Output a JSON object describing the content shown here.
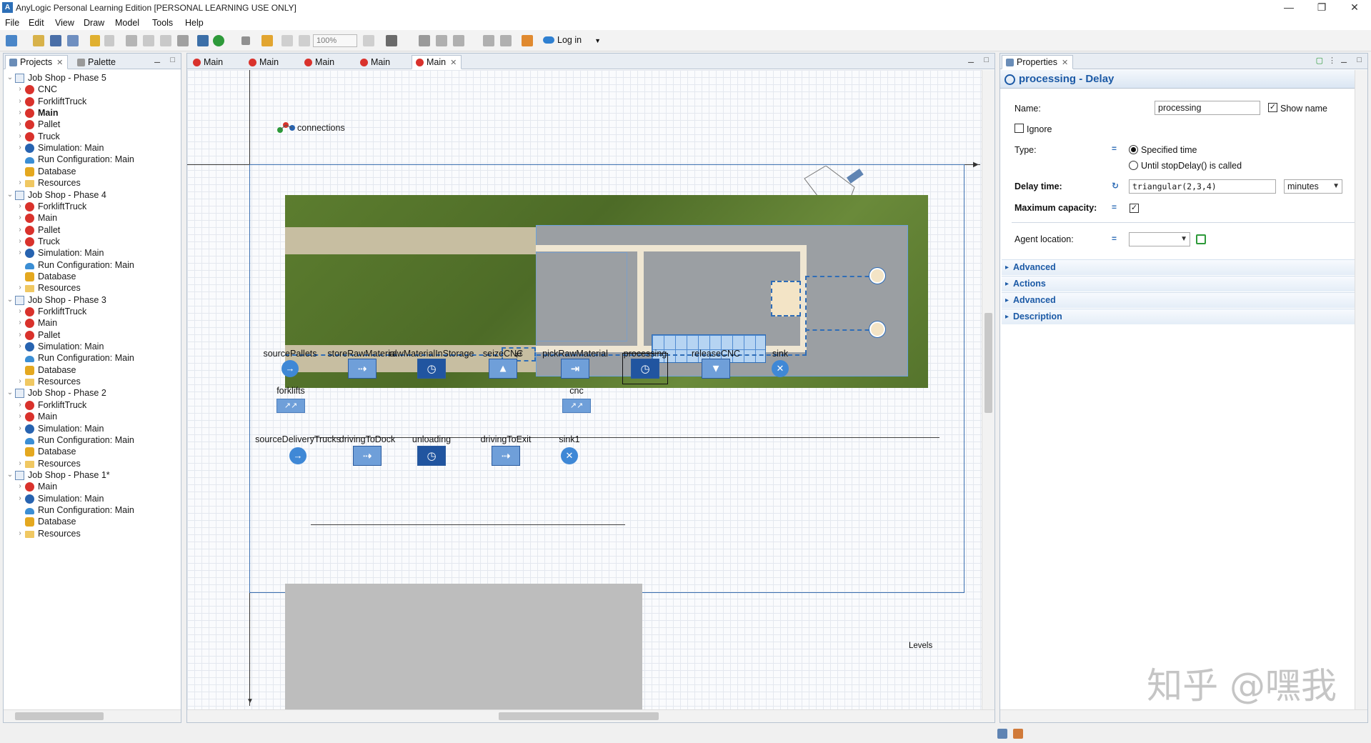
{
  "window": {
    "title": "AnyLogic Personal Learning Edition [PERSONAL LEARNING USE ONLY]",
    "controls": [
      "—",
      "❐",
      "✕"
    ]
  },
  "menu": [
    "File",
    "Edit",
    "View",
    "Draw",
    "Model",
    "Tools",
    "Help"
  ],
  "toolbar": {
    "zoom": "100%",
    "login": "Log in"
  },
  "left_panel": {
    "tabs": [
      {
        "label": "Projects",
        "close": "✕"
      },
      {
        "label": "Palette"
      }
    ],
    "tree": [
      {
        "label": "Job Shop - Phase 5",
        "icon": "project-icon",
        "depth": 0,
        "arrow": "⌄"
      },
      {
        "label": "CNC",
        "icon": "agent-icon",
        "depth": 1,
        "arrow": "›"
      },
      {
        "label": "ForkliftTruck",
        "icon": "agent-icon",
        "depth": 1,
        "arrow": "›"
      },
      {
        "label": "Main",
        "icon": "agent-icon",
        "depth": 1,
        "arrow": "›",
        "bold": true
      },
      {
        "label": "Pallet",
        "icon": "agent-icon",
        "depth": 1,
        "arrow": "›"
      },
      {
        "label": "Truck",
        "icon": "agent-icon",
        "depth": 1,
        "arrow": "›"
      },
      {
        "label": "Simulation: Main",
        "icon": "simulation-icon",
        "depth": 1,
        "arrow": "›"
      },
      {
        "label": "Run Configuration: Main",
        "icon": "run-config-icon",
        "depth": 1,
        "arrow": ""
      },
      {
        "label": "Database",
        "icon": "database-icon",
        "depth": 1,
        "arrow": ""
      },
      {
        "label": "Resources",
        "icon": "folder-icon",
        "depth": 1,
        "arrow": "›"
      },
      {
        "label": "Job Shop - Phase 4",
        "icon": "project-icon",
        "depth": 0,
        "arrow": "⌄"
      },
      {
        "label": "ForkliftTruck",
        "icon": "agent-icon",
        "depth": 1,
        "arrow": "›"
      },
      {
        "label": "Main",
        "icon": "agent-icon",
        "depth": 1,
        "arrow": "›"
      },
      {
        "label": "Pallet",
        "icon": "agent-icon",
        "depth": 1,
        "arrow": "›"
      },
      {
        "label": "Truck",
        "icon": "agent-icon",
        "depth": 1,
        "arrow": "›"
      },
      {
        "label": "Simulation: Main",
        "icon": "simulation-icon",
        "depth": 1,
        "arrow": "›"
      },
      {
        "label": "Run Configuration: Main",
        "icon": "run-config-icon",
        "depth": 1,
        "arrow": ""
      },
      {
        "label": "Database",
        "icon": "database-icon",
        "depth": 1,
        "arrow": ""
      },
      {
        "label": "Resources",
        "icon": "folder-icon",
        "depth": 1,
        "arrow": "›"
      },
      {
        "label": "Job Shop - Phase 3",
        "icon": "project-icon",
        "depth": 0,
        "arrow": "⌄"
      },
      {
        "label": "ForkliftTruck",
        "icon": "agent-icon",
        "depth": 1,
        "arrow": "›"
      },
      {
        "label": "Main",
        "icon": "agent-icon",
        "depth": 1,
        "arrow": "›"
      },
      {
        "label": "Pallet",
        "icon": "agent-icon",
        "depth": 1,
        "arrow": "›"
      },
      {
        "label": "Simulation: Main",
        "icon": "simulation-icon",
        "depth": 1,
        "arrow": "›"
      },
      {
        "label": "Run Configuration: Main",
        "icon": "run-config-icon",
        "depth": 1,
        "arrow": ""
      },
      {
        "label": "Database",
        "icon": "database-icon",
        "depth": 1,
        "arrow": ""
      },
      {
        "label": "Resources",
        "icon": "folder-icon",
        "depth": 1,
        "arrow": "›"
      },
      {
        "label": "Job Shop - Phase 2",
        "icon": "project-icon",
        "depth": 0,
        "arrow": "⌄"
      },
      {
        "label": "ForkliftTruck",
        "icon": "agent-icon",
        "depth": 1,
        "arrow": "›"
      },
      {
        "label": "Main",
        "icon": "agent-icon",
        "depth": 1,
        "arrow": "›"
      },
      {
        "label": "Simulation: Main",
        "icon": "simulation-icon",
        "depth": 1,
        "arrow": "›"
      },
      {
        "label": "Run Configuration: Main",
        "icon": "run-config-icon",
        "depth": 1,
        "arrow": ""
      },
      {
        "label": "Database",
        "icon": "database-icon",
        "depth": 1,
        "arrow": ""
      },
      {
        "label": "Resources",
        "icon": "folder-icon",
        "depth": 1,
        "arrow": "›"
      },
      {
        "label": "Job Shop - Phase 1*",
        "icon": "project-icon",
        "depth": 0,
        "arrow": "⌄"
      },
      {
        "label": "Main",
        "icon": "agent-icon",
        "depth": 1,
        "arrow": "›"
      },
      {
        "label": "Simulation: Main",
        "icon": "simulation-icon",
        "depth": 1,
        "arrow": "›"
      },
      {
        "label": "Run Configuration: Main",
        "icon": "run-config-icon",
        "depth": 1,
        "arrow": ""
      },
      {
        "label": "Database",
        "icon": "database-icon",
        "depth": 1,
        "arrow": ""
      },
      {
        "label": "Resources",
        "icon": "folder-icon",
        "depth": 1,
        "arrow": "›"
      }
    ]
  },
  "editor": {
    "tabs": [
      "Main",
      "Main",
      "Main",
      "Main",
      "Main"
    ],
    "active_tab_close": "✕",
    "connections_label": "connections",
    "levels_label": "Levels",
    "flow1": {
      "blocks": [
        {
          "label": "sourcePallets",
          "kind": "source",
          "glyph": "→"
        },
        {
          "label": "storeRawMaterial",
          "kind": "store",
          "glyph": "⇢"
        },
        {
          "label": "rawMaterialInStorage",
          "kind": "delay",
          "glyph": "◷"
        },
        {
          "label": "seizeCNC",
          "kind": "seize",
          "glyph": "▲"
        },
        {
          "label": "pickRawMaterial",
          "kind": "retrieve",
          "glyph": "⇥"
        },
        {
          "label": "processing",
          "kind": "delay-selected",
          "glyph": "◷"
        },
        {
          "label": "releaseCNC",
          "kind": "release",
          "glyph": "▼"
        },
        {
          "label": "sink",
          "kind": "sink",
          "glyph": "✕"
        }
      ]
    },
    "pools": [
      {
        "label": "forklifts",
        "glyph": "↗↗"
      },
      {
        "label": "cnc",
        "glyph": "↗↗"
      }
    ],
    "flow2": {
      "blocks": [
        {
          "label": "sourceDeliveryTrucks",
          "kind": "source",
          "glyph": "→"
        },
        {
          "label": "drivingToDock",
          "kind": "move",
          "glyph": "⇢"
        },
        {
          "label": "unloading",
          "kind": "delay",
          "glyph": "◷"
        },
        {
          "label": "drivingToExit",
          "kind": "move",
          "glyph": "⇢"
        },
        {
          "label": "sink1",
          "kind": "sink",
          "glyph": "✕"
        }
      ]
    }
  },
  "properties": {
    "tab_label": "Properties",
    "tab_close": "✕",
    "title": "processing - Delay",
    "name_label": "Name:",
    "name_value": "processing",
    "show_name_label": "Show name",
    "show_name_checked": true,
    "ignore_label": "Ignore",
    "ignore_checked": false,
    "type_label": "Type:",
    "type_options": [
      "Specified time",
      "Until stopDelay() is called"
    ],
    "type_selected": "Specified time",
    "delay_time_label": "Delay time:",
    "delay_time_value": "triangular(2,3,4)",
    "delay_unit": "minutes",
    "max_capacity_label": "Maximum capacity:",
    "max_capacity_checked": true,
    "agent_location_label": "Agent location:",
    "agent_location_value": "",
    "sections": [
      "Advanced",
      "Actions",
      "Advanced",
      "Description"
    ]
  },
  "watermark": "知乎 @嘿我",
  "colors": {
    "accent": "#1c5aa6",
    "block_blue": "#3e77c4",
    "grass": "#5a7a2e",
    "floor": "#9b9fa3",
    "path": "#2f6db7"
  }
}
